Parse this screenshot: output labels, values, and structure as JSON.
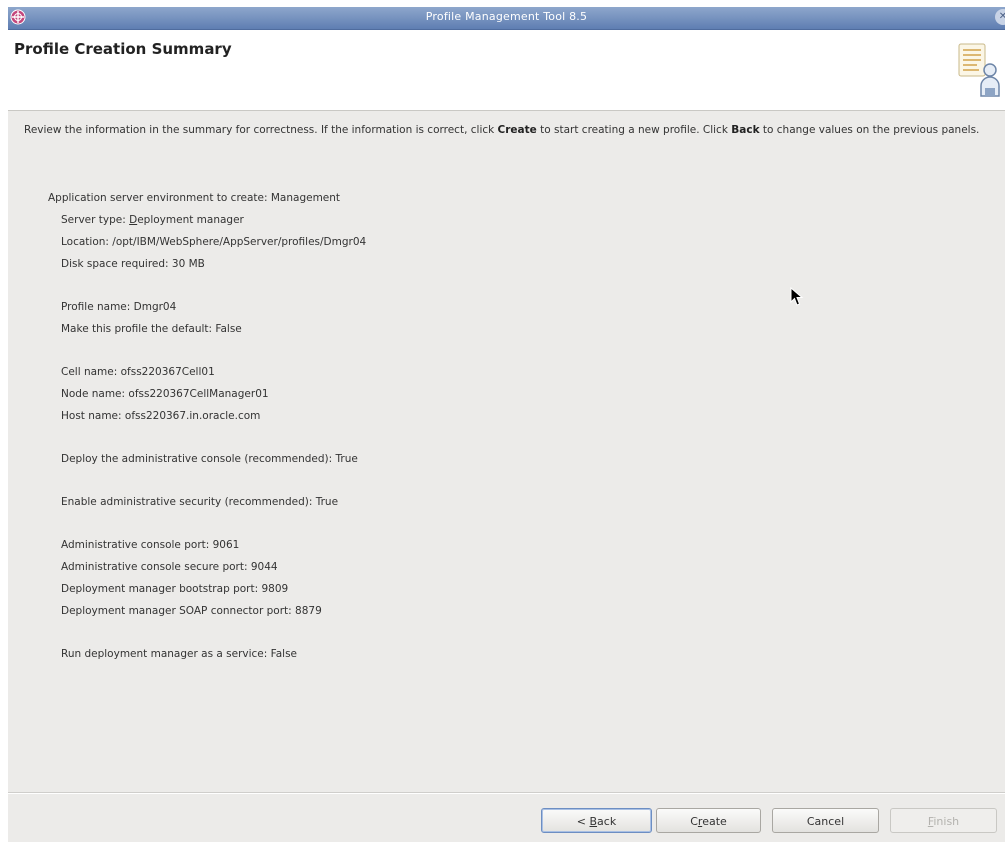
{
  "window": {
    "title": "Profile Management Tool 8.5",
    "close_glyph": "✕"
  },
  "header": {
    "title": "Profile Creation Summary"
  },
  "description": {
    "part1": "Review the information in the summary for correctness. If the information is correct, click ",
    "create_word": "Create",
    "part2": " to start creating a new profile. Click ",
    "back_word": "Back",
    "part3": " to change values on the previous panels."
  },
  "summary": {
    "environment": "Application server environment to create: Management",
    "server_type_prefix": "Server type: ",
    "server_type_mnemonic": "D",
    "server_type_rest": "eployment manager",
    "location": "Location: /opt/IBM/WebSphere/AppServer/profiles/Dmgr04",
    "disk_space": "Disk space required: 30 MB",
    "profile_name": "Profile name: Dmgr04",
    "default_profile": "Make this profile the default: False",
    "cell_name": "Cell name: ofss220367Cell01",
    "node_name": "Node name: ofss220367CellManager01",
    "host_name": "Host name: ofss220367.in.oracle.com",
    "deploy_console": "Deploy the administrative console (recommended): True",
    "admin_security": "Enable administrative security (recommended): True",
    "console_port": "Administrative console port: 9061",
    "console_secure_port": "Administrative console secure port: 9044",
    "bootstrap_port": "Deployment manager bootstrap port: 9809",
    "soap_port": "Deployment manager SOAP connector port: 8879",
    "run_as_service": "Run deployment manager as a service: False"
  },
  "buttons": {
    "back_prefix": "< ",
    "back_mnemonic": "B",
    "back_rest": "ack",
    "create_pre": "C",
    "create_mnemonic": "r",
    "create_rest": "eate",
    "cancel": "Cancel",
    "finish_mnemonic": "F",
    "finish_rest": "inish"
  },
  "icons": {
    "app": "websphere-globe-icon",
    "header": "profile-document-person-icon",
    "cursor": "mouse-pointer-icon"
  },
  "colors": {
    "titlebar": "#6f8cbf",
    "background": "#ecebe9",
    "header_bg": "#ffffff"
  }
}
